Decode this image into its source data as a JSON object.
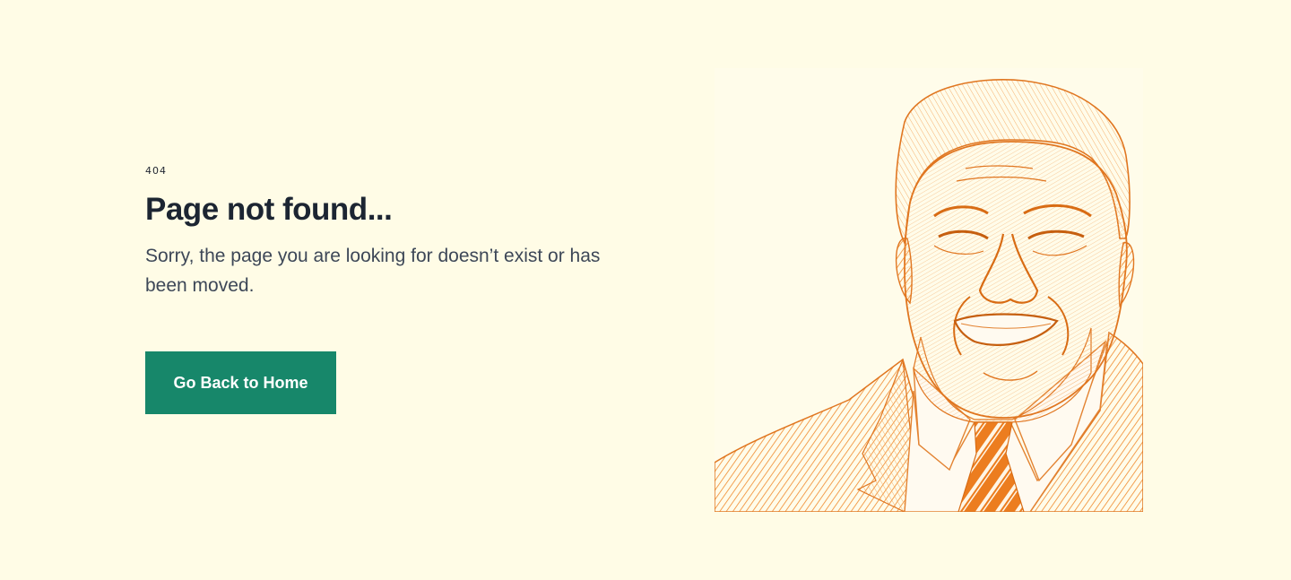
{
  "error": {
    "code": "404",
    "title": "Page not found...",
    "message": "Sorry, the page you are looking for doesn’t exist or has been moved."
  },
  "actions": {
    "home_button_label": "Go Back to Home"
  },
  "colors": {
    "background": "#fffce6",
    "heading": "#1c2532",
    "body_text": "#3d4757",
    "button": "#17876a",
    "illustration": "#f08a2c"
  },
  "illustration": {
    "subject": "engraved-portrait-illustration",
    "icon": "smiling-man-portrait"
  }
}
